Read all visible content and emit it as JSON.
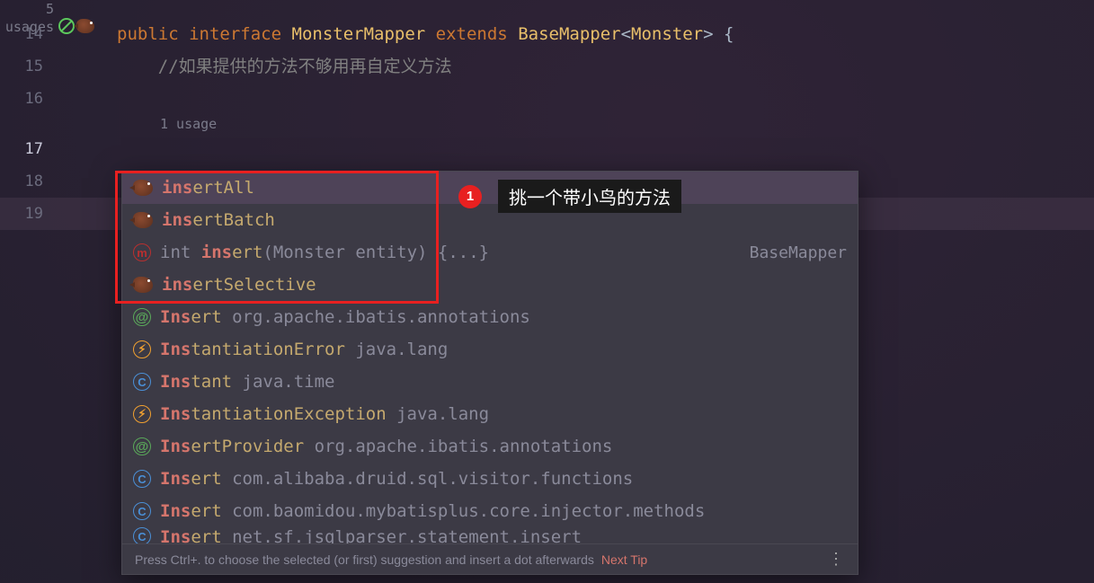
{
  "gutter": {
    "usages_top": "5 usages",
    "lines": [
      "14",
      "15",
      "16",
      "17",
      "18",
      "19"
    ],
    "usages_inline": "1 usage"
  },
  "code": {
    "kw_public": "public",
    "kw_interface": "interface",
    "type_name": "MonsterMapper",
    "kw_extends": "extends",
    "base_type": "BaseMapper",
    "generic_open": "<",
    "generic_type": "Monster",
    "generic_close": ">",
    "brace_open": " {",
    "comment": "//如果提供的方法不够用再自定义方法",
    "typed": "ins"
  },
  "popup": {
    "items": [
      {
        "icon": "bird",
        "prefix": "ins",
        "rest": "ertAll",
        "right": ""
      },
      {
        "icon": "bird",
        "prefix": "ins",
        "rest": "ertBatch",
        "right": ""
      },
      {
        "icon": "m",
        "ret": "int ",
        "prefix": "ins",
        "rest": "ert",
        "params": "(Monster entity)",
        "body": " {...}",
        "right": "BaseMapper"
      },
      {
        "icon": "bird",
        "prefix": "ins",
        "rest": "ertSelective",
        "right": ""
      },
      {
        "icon": "at",
        "prefix": "Ins",
        "rest": "ert",
        "pkg": " org.apache.ibatis.annotations"
      },
      {
        "icon": "lightning",
        "prefix": "Ins",
        "rest": "tantiationError",
        "pkg": " java.lang"
      },
      {
        "icon": "c",
        "prefix": "Ins",
        "rest": "tant",
        "pkg": " java.time"
      },
      {
        "icon": "lightning",
        "prefix": "Ins",
        "rest": "tantiationException",
        "pkg": " java.lang"
      },
      {
        "icon": "at",
        "prefix": "Ins",
        "rest": "ertProvider",
        "pkg": " org.apache.ibatis.annotations"
      },
      {
        "icon": "c",
        "prefix": "Ins",
        "rest": "ert",
        "pkg": " com.alibaba.druid.sql.visitor.functions"
      },
      {
        "icon": "c",
        "prefix": "Ins",
        "rest": "ert",
        "pkg": " com.baomidou.mybatisplus.core.injector.methods"
      }
    ],
    "truncated": {
      "icon": "c",
      "prefix": "Ins",
      "rest": "ert",
      "pkg": " net.sf.jsqlparser.statement.insert"
    },
    "footer_text": "Press Ctrl+. to choose the selected (or first) suggestion and insert a dot afterwards",
    "next_tip": "Next Tip",
    "menu_dots": "⋮"
  },
  "annotation": {
    "badge": "1",
    "text": "挑一个带小鸟的方法"
  }
}
